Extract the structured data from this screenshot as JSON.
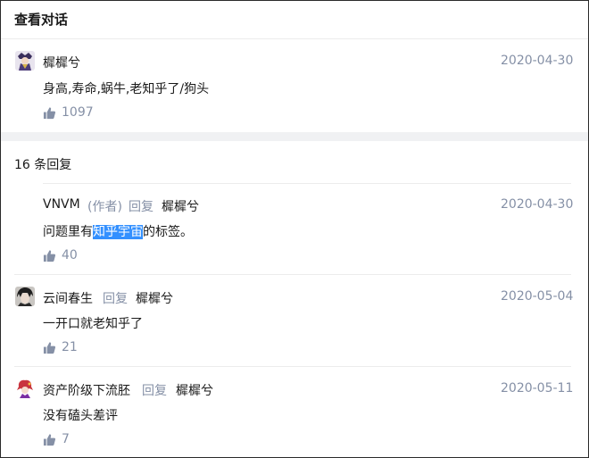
{
  "header": {
    "title": "查看对话"
  },
  "main_comment": {
    "author": "樨樨兮",
    "date": "2020-04-30",
    "content": "身高,寿命,蜗牛,老知乎了/狗头",
    "likes": "1097"
  },
  "replies_title": "16 条回复",
  "replies": [
    {
      "author": "VNVM",
      "author_tag": "(作者)",
      "reply_word": "回复",
      "reply_to": "樨樨兮",
      "date": "2020-04-30",
      "content_before": "问题里有",
      "content_highlight": "知乎宇宙",
      "content_after": "的标签。",
      "likes": "40"
    },
    {
      "author": "云间春生",
      "reply_word": "回复",
      "reply_to": "樨樨兮",
      "date": "2020-05-04",
      "content": "一开口就老知乎了",
      "likes": "21"
    },
    {
      "author": "资产阶级下流胚",
      "reply_word": "回复",
      "reply_to": "樨樨兮",
      "date": "2020-05-11",
      "content": "没有磕头差评",
      "likes": "7"
    }
  ],
  "icons": {
    "like": "thumbs-up-icon"
  },
  "colors": {
    "meta": "#8590a6",
    "highlight": "#3390ff",
    "divider": "#ececec"
  }
}
